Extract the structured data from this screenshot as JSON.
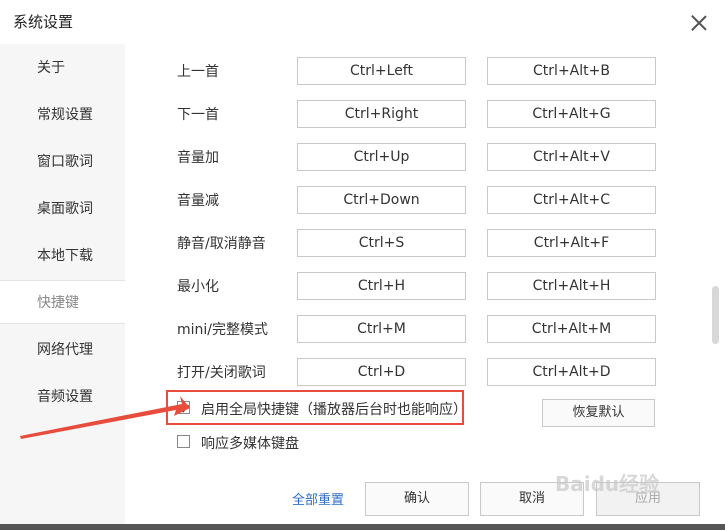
{
  "window": {
    "title": "系统设置"
  },
  "sidebar": {
    "items": [
      {
        "label": "关于"
      },
      {
        "label": "常规设置"
      },
      {
        "label": "窗口歌词"
      },
      {
        "label": "桌面歌词"
      },
      {
        "label": "本地下载"
      },
      {
        "label": "快捷键",
        "active": true
      },
      {
        "label": "网络代理"
      },
      {
        "label": "音频设置"
      }
    ]
  },
  "shortcuts": [
    {
      "action": "上一首",
      "key": "Ctrl+Left",
      "global_key": "Ctrl+Alt+B"
    },
    {
      "action": "下一首",
      "key": "Ctrl+Right",
      "global_key": "Ctrl+Alt+G"
    },
    {
      "action": "音量加",
      "key": "Ctrl+Up",
      "global_key": "Ctrl+Alt+V"
    },
    {
      "action": "音量减",
      "key": "Ctrl+Down",
      "global_key": "Ctrl+Alt+C"
    },
    {
      "action": "静音/取消静音",
      "key": "Ctrl+S",
      "global_key": "Ctrl+Alt+F"
    },
    {
      "action": "最小化",
      "key": "Ctrl+H",
      "global_key": "Ctrl+Alt+H"
    },
    {
      "action": "mini/完整模式",
      "key": "Ctrl+M",
      "global_key": "Ctrl+Alt+M"
    },
    {
      "action": "打开/关闭歌词",
      "key": "Ctrl+D",
      "global_key": "Ctrl+Alt+D"
    }
  ],
  "options": {
    "global_hotkeys": {
      "label": "启用全局快捷键（播放器后台时也能响应）",
      "checked": true
    },
    "media_keyboard": {
      "label": "响应多媒体键盘",
      "checked": false
    }
  },
  "buttons": {
    "restore_default": "恢复默认",
    "reset_all": "全部重置",
    "ok": "确认",
    "cancel": "取消",
    "apply": "应用"
  },
  "annotation": {
    "highlight_color": "#e74c3c"
  },
  "watermark": {
    "text": "Baidu经验"
  }
}
